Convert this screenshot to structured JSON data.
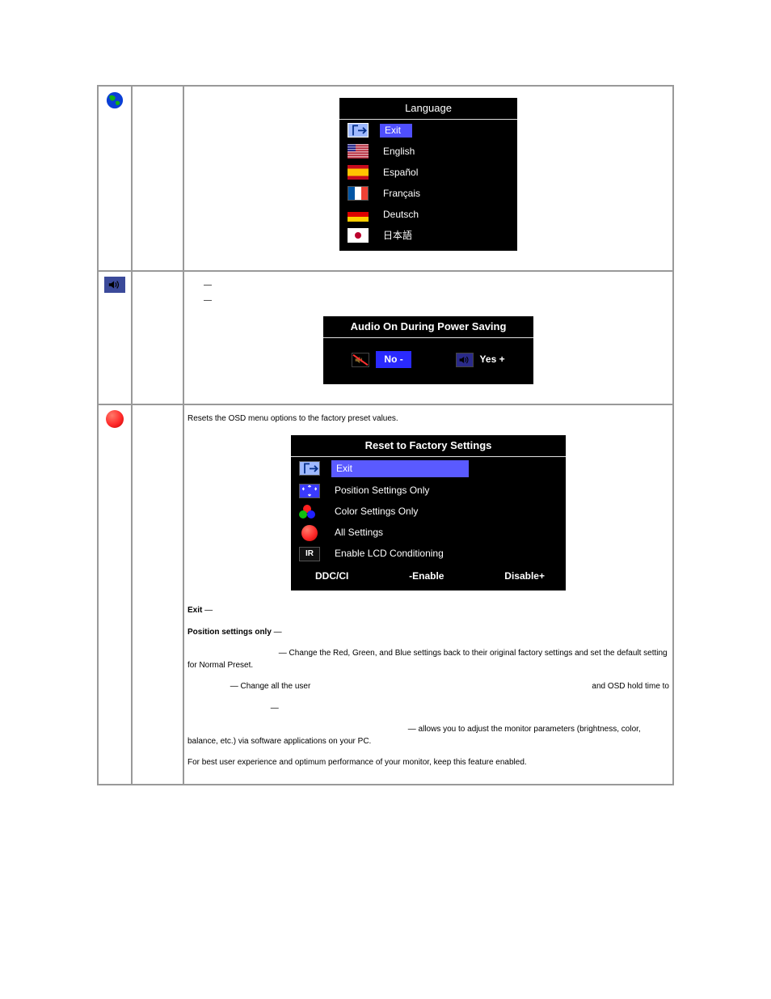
{
  "rows": {
    "language": {
      "osd_title": "Language",
      "items": [
        {
          "label": "Exit"
        },
        {
          "label": "English"
        },
        {
          "label": "Español"
        },
        {
          "label": "Français"
        },
        {
          "label": "Deutsch"
        },
        {
          "label": "日本語"
        }
      ]
    },
    "audio": {
      "osd_title": "Audio On During Power Saving",
      "no": "No -",
      "yes": "Yes +"
    },
    "reset": {
      "intro": "Resets the OSD menu options to  the factory preset values.",
      "osd_title": "Reset to Factory Settings",
      "items": [
        {
          "label": "Exit"
        },
        {
          "label": "Position Settings Only"
        },
        {
          "label": "Color Settings Only"
        },
        {
          "label": "All Settings"
        },
        {
          "label": "Enable LCD Conditioning"
        }
      ],
      "ddc": {
        "label": "DDC/CI",
        "left": "-Enable",
        "right": "Disable+"
      },
      "exit_line_prefix": "Exit",
      "exit_line_dash": " — ",
      "pos_line_prefix": "Position settings only",
      "pos_line_dash": " — ",
      "color_line": " — Change the Red, Green, and Blue settings back to their original factory settings and set  the default setting for Normal Preset.",
      "all_line_a": " — Change all the user",
      "all_line_b": "and OSD hold time  to",
      "dash_only": " — ",
      "ddc_line": " — allows you to adjust the monitor parameters (brightness, color, balance, etc.)  via software applications on your PC.",
      "best_line": "For best user experience and optimum performance of your monitor, keep this feature enabled."
    }
  }
}
